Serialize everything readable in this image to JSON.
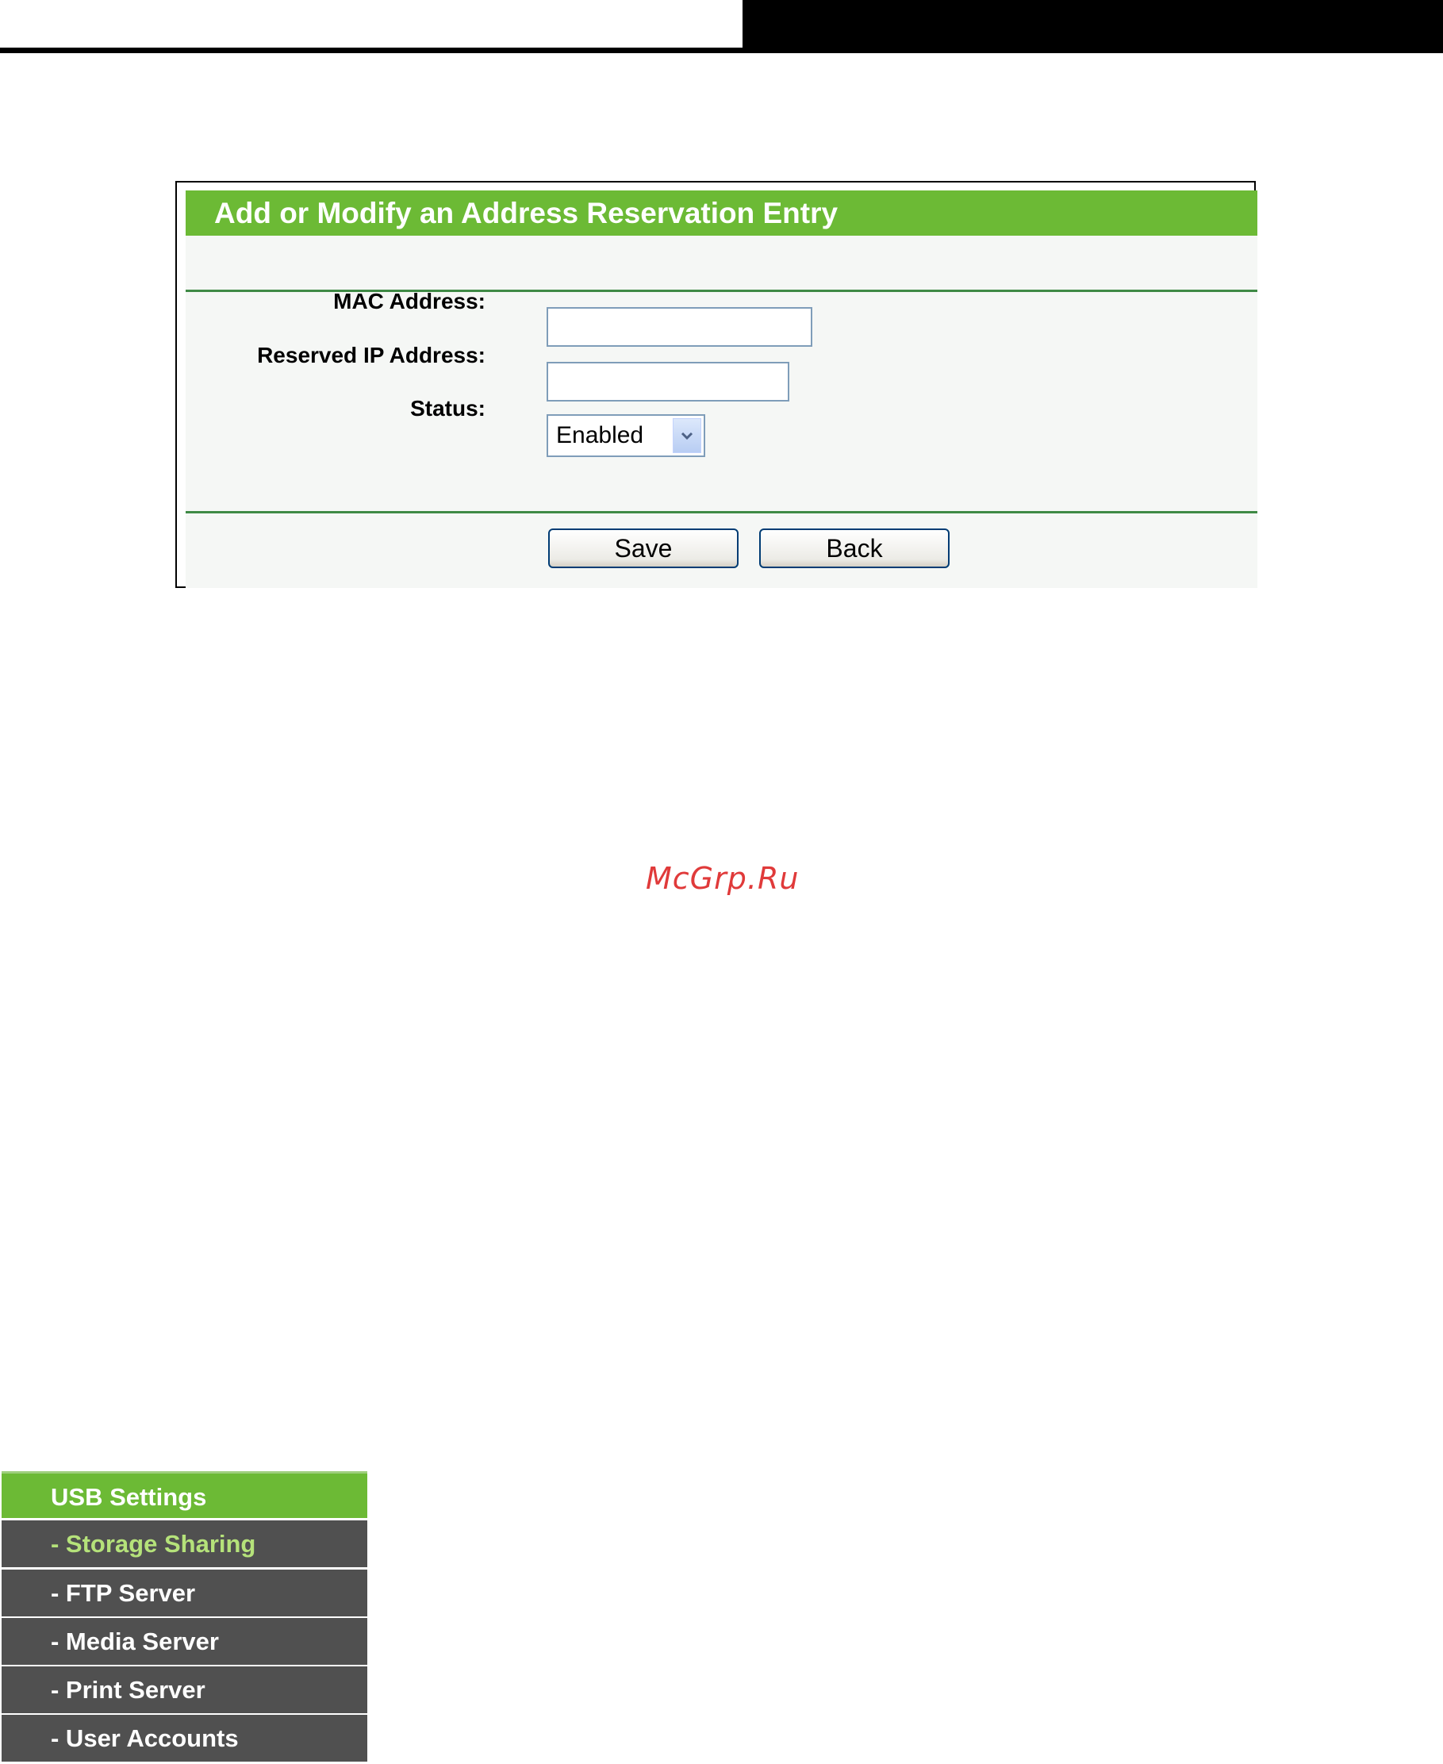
{
  "panel": {
    "title": "Add or Modify an Address Reservation Entry",
    "mac_label": "MAC Address:",
    "mac_value": "",
    "ip_label": "Reserved IP Address:",
    "ip_value": "",
    "status_label": "Status:",
    "status_value": "Enabled",
    "save_label": "Save",
    "back_label": "Back"
  },
  "watermark": "McGrp.Ru",
  "menu": {
    "header": "USB Settings",
    "items": [
      {
        "label": "- Storage Sharing",
        "active": true
      },
      {
        "label": "- FTP Server",
        "active": false
      },
      {
        "label": "- Media Server",
        "active": false
      },
      {
        "label": "- Print Server",
        "active": false
      },
      {
        "label": "- User Accounts",
        "active": false
      }
    ]
  },
  "colors": {
    "accent_green": "#6cba35",
    "menu_gray": "#505050",
    "active_text": "#b5e27a",
    "divider_green": "#3f8a45"
  }
}
